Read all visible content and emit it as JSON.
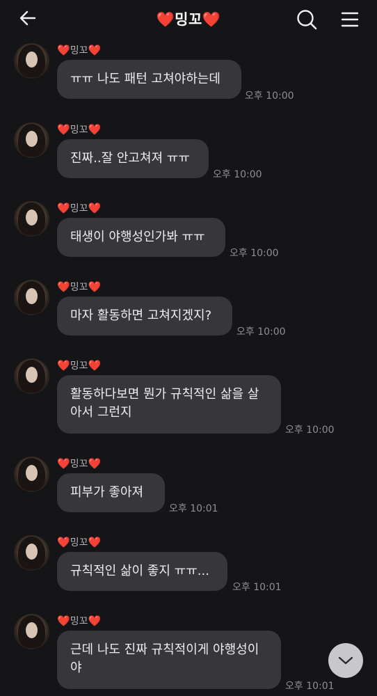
{
  "header": {
    "title_heart_left": "❤️",
    "title_name": "밍꼬",
    "title_heart_right": "❤️",
    "back_icon": "arrow-left-icon",
    "search_icon": "search-icon",
    "menu_icon": "hamburger-menu-icon"
  },
  "messages": [
    {
      "sender_heart_left": "❤️",
      "sender_name": "밍꼬",
      "sender_heart_right": "❤️",
      "lines": [
        "ㅠㅠ 나도 패턴 고쳐야하는데"
      ],
      "time": "오후 10:00"
    },
    {
      "sender_heart_left": "❤️",
      "sender_name": "밍꼬",
      "sender_heart_right": "❤️",
      "lines": [
        "진짜..잘 안고쳐져 ㅠㅠ"
      ],
      "time": "오후 10:00"
    },
    {
      "sender_heart_left": "❤️",
      "sender_name": "밍꼬",
      "sender_heart_right": "❤️",
      "lines": [
        "태생이 야행성인가봐 ㅠㅠ"
      ],
      "time": "오후 10:00"
    },
    {
      "sender_heart_left": "❤️",
      "sender_name": "밍꼬",
      "sender_heart_right": "❤️",
      "lines": [
        "마자 활동하면 고쳐지겠지?"
      ],
      "time": "오후 10:00"
    },
    {
      "sender_heart_left": "❤️",
      "sender_name": "밍꼬",
      "sender_heart_right": "❤️",
      "lines": [
        "활동하다보면 뭔가 규칙적인 삶을 살",
        "아서 그런지"
      ],
      "time": "오후 10:00"
    },
    {
      "sender_heart_left": "❤️",
      "sender_name": "밍꼬",
      "sender_heart_right": "❤️",
      "lines": [
        "피부가 좋아져"
      ],
      "time": "오후 10:01"
    },
    {
      "sender_heart_left": "❤️",
      "sender_name": "밍꼬",
      "sender_heart_right": "❤️",
      "lines": [
        "규칙적인 삶이 좋지 ㅠㅠ..."
      ],
      "time": "오후 10:01"
    },
    {
      "sender_heart_left": "❤️",
      "sender_name": "밍꼬",
      "sender_heart_right": "❤️",
      "lines": [
        "근데 나도 진짜 규칙적이게 야행성이",
        "야"
      ],
      "time": "오후 10:01"
    }
  ],
  "scroll_button": {
    "icon": "chevron-down-icon"
  },
  "colors": {
    "background": "#151518",
    "bubble": "#36363b",
    "heart": "#e8141f",
    "time_text": "#8e8e94"
  }
}
